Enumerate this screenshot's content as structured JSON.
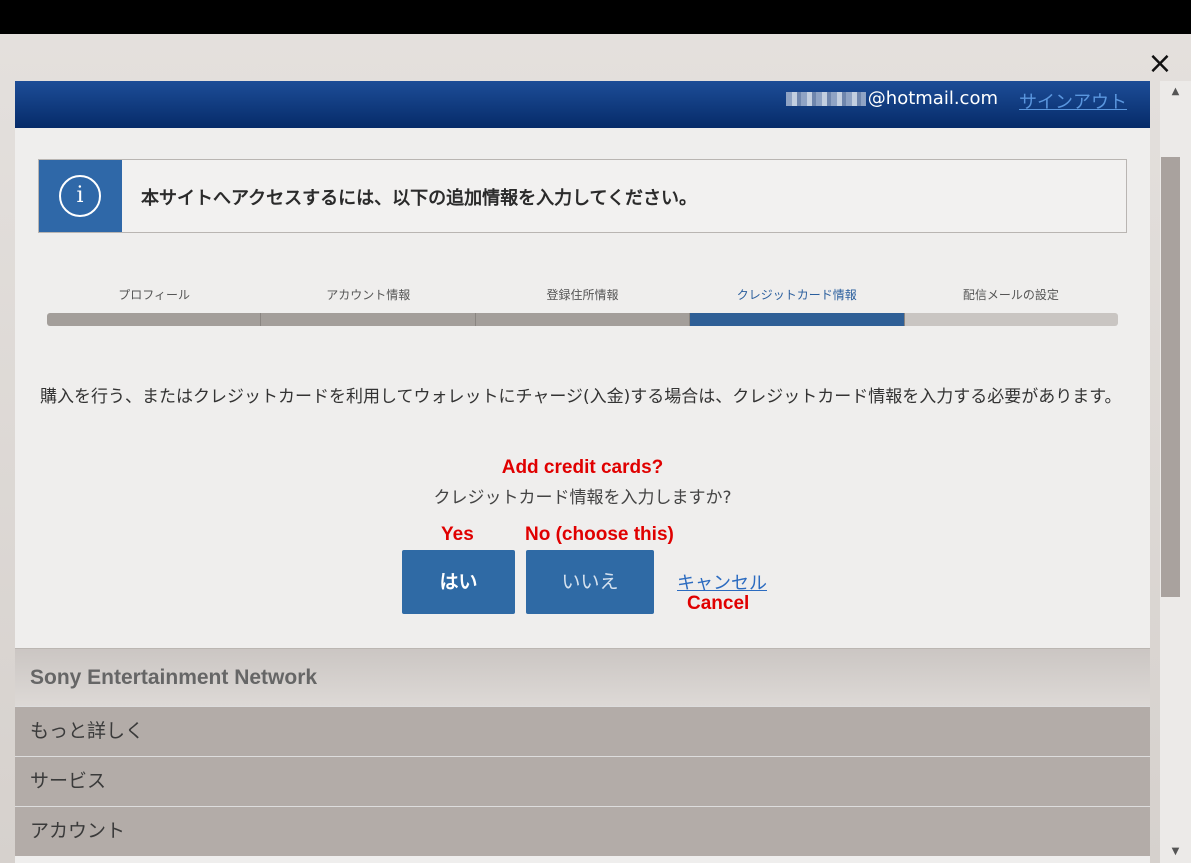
{
  "close_label": "×",
  "header": {
    "email_suffix": "@hotmail.com",
    "signout": "サインアウト"
  },
  "info": {
    "icon": "i",
    "message": "本サイトへアクセスするには、以下の追加情報を入力してください。"
  },
  "steps": [
    "プロフィール",
    "アカウント情報",
    "登録住所情報",
    "クレジットカード情報",
    "配信メールの設定"
  ],
  "description": "購入を行う、またはクレジットカードを利用してウォレットにチャージ(入金)する場合は、クレジットカード情報を入力する必要があります。",
  "annotations": {
    "title": "Add credit cards?",
    "yes": "Yes",
    "no": "No (choose this)",
    "cancel": "Cancel"
  },
  "question": "クレジットカード情報を入力しますか?",
  "buttons": {
    "yes": "はい",
    "no": "いいえ",
    "cancel": "キャンセル"
  },
  "footer": {
    "title": "Sony Entertainment Network",
    "items": [
      "もっと詳しく",
      "サービス",
      "アカウント"
    ]
  }
}
